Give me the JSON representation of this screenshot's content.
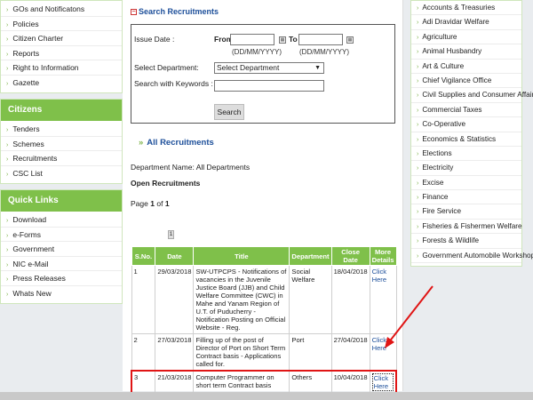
{
  "left_sidebar": {
    "top_items": [
      "GOs and Notificatons",
      "Policies",
      "Citizen Charter",
      "Reports",
      "Right to Information",
      "Gazette"
    ],
    "citizens": {
      "title": "Citizens",
      "items": [
        "Tenders",
        "Schemes",
        "Recruitments",
        "CSC List"
      ]
    },
    "quick_links": {
      "title": "Quick Links",
      "items": [
        "Download",
        "e-Forms",
        "Government",
        "NIC e-Mail",
        "Press Releases",
        "Whats New"
      ]
    }
  },
  "search": {
    "section_title": "Search Recruitments",
    "issue_date_label": "Issue Date :",
    "from_label": "From",
    "to_label": "To",
    "date_hint": "(DD/MM/YYYY)",
    "department_label": "Select Department:",
    "department_selected": "Select Department",
    "keywords_label": "Search with Keywords :",
    "search_button": "Search"
  },
  "listing": {
    "heading": "All Recruitments",
    "department_name": "Department Name: All Departments",
    "open_label": "Open Recruitments",
    "page_prefix": "Page",
    "page_current": "1",
    "page_of": "of",
    "page_total": "1",
    "pager_symbol": "1"
  },
  "table": {
    "headers": [
      "S.No.",
      "Date",
      "Title",
      "Department",
      "Close Date",
      "More Details"
    ],
    "rows": [
      {
        "sno": "1",
        "date": "29/03/2018",
        "title": "SW-UTPCPS - Notifications of vacancies in the Juvenile Justice Board (JJB) and Child Welfare Committee (CWC) in Mahe and Yanam Region of U.T. of Puducherry - Notification Posting on Official Website - Reg.",
        "department": "Social Welfare",
        "close": "18/04/2018",
        "link": "Click Here"
      },
      {
        "sno": "2",
        "date": "27/03/2018",
        "title": "Filling up of the post of Director of Port on Short Term Contract basis - Applications called for.",
        "department": "Port",
        "close": "27/04/2018",
        "link": "Click Here"
      },
      {
        "sno": "3",
        "date": "21/03/2018",
        "title": "Computer Programmer on short term Contract basis",
        "department": "Others",
        "close": "10/04/2018",
        "link": "Click Here"
      }
    ]
  },
  "right_sidebar": {
    "items": [
      "Accounts & Treasuries",
      "Adi Dravidar Welfare",
      "Agriculture",
      "Animal Husbandry",
      "Art & Culture",
      "Chief Vigilance Office",
      "Civil Supplies and Consumer Affairs",
      "Commercial Taxes",
      "Co-Operative",
      "Economics & Statistics",
      "Elections",
      "Electricity",
      "Excise",
      "Finance",
      "Fire Service",
      "Fisheries & Fishermen Welfare",
      "Forests & Wildlife",
      "Government Automobile Workshop"
    ]
  },
  "colors": {
    "accent_green": "#7fc04a",
    "link_blue": "#1d4f9a",
    "highlight_red": "#e01515"
  }
}
